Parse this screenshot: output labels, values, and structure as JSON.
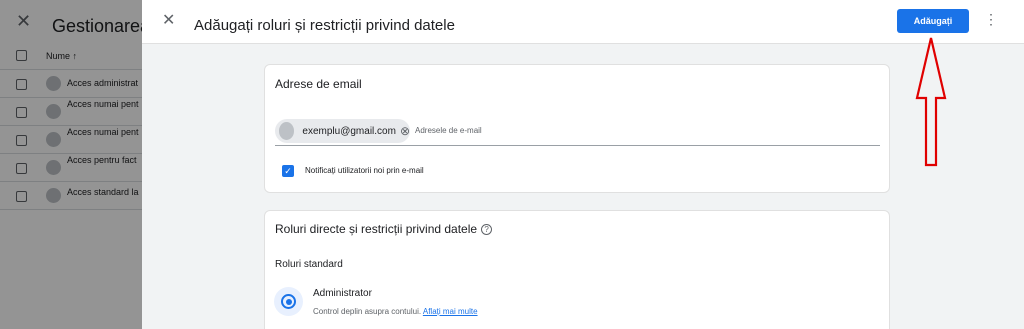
{
  "background": {
    "title": "Gestionarea a",
    "column_header": "Nume ↑",
    "rows": [
      "Acces administrat",
      "Acces numai pent",
      "Acces numai pent",
      "Acces pentru fact",
      "Acces standard la"
    ]
  },
  "dialog": {
    "title": "Adăugați roluri și restricții privind datele",
    "add_button": "Adăugați",
    "more_icon": "more-vert-icon",
    "close_icon": "close-icon"
  },
  "email_card": {
    "heading": "Adrese de email",
    "chip_email": "exemplu@gmail.com",
    "input_placeholder": "Adresele de e-mail",
    "notify_label": "Notificați utilizatorii noi prin e-mail",
    "notify_checked": true
  },
  "roles_card": {
    "heading": "Roluri directe și restricții privind datele",
    "help_icon": "help-icon",
    "standard_heading": "Roluri standard",
    "option_title": "Administrator",
    "option_desc": "Control deplin asupra contului.",
    "option_link": "Aflați mai multe",
    "option_selected": true
  },
  "colors": {
    "accent": "#1a73e8",
    "annotation_arrow": "#e00000"
  }
}
